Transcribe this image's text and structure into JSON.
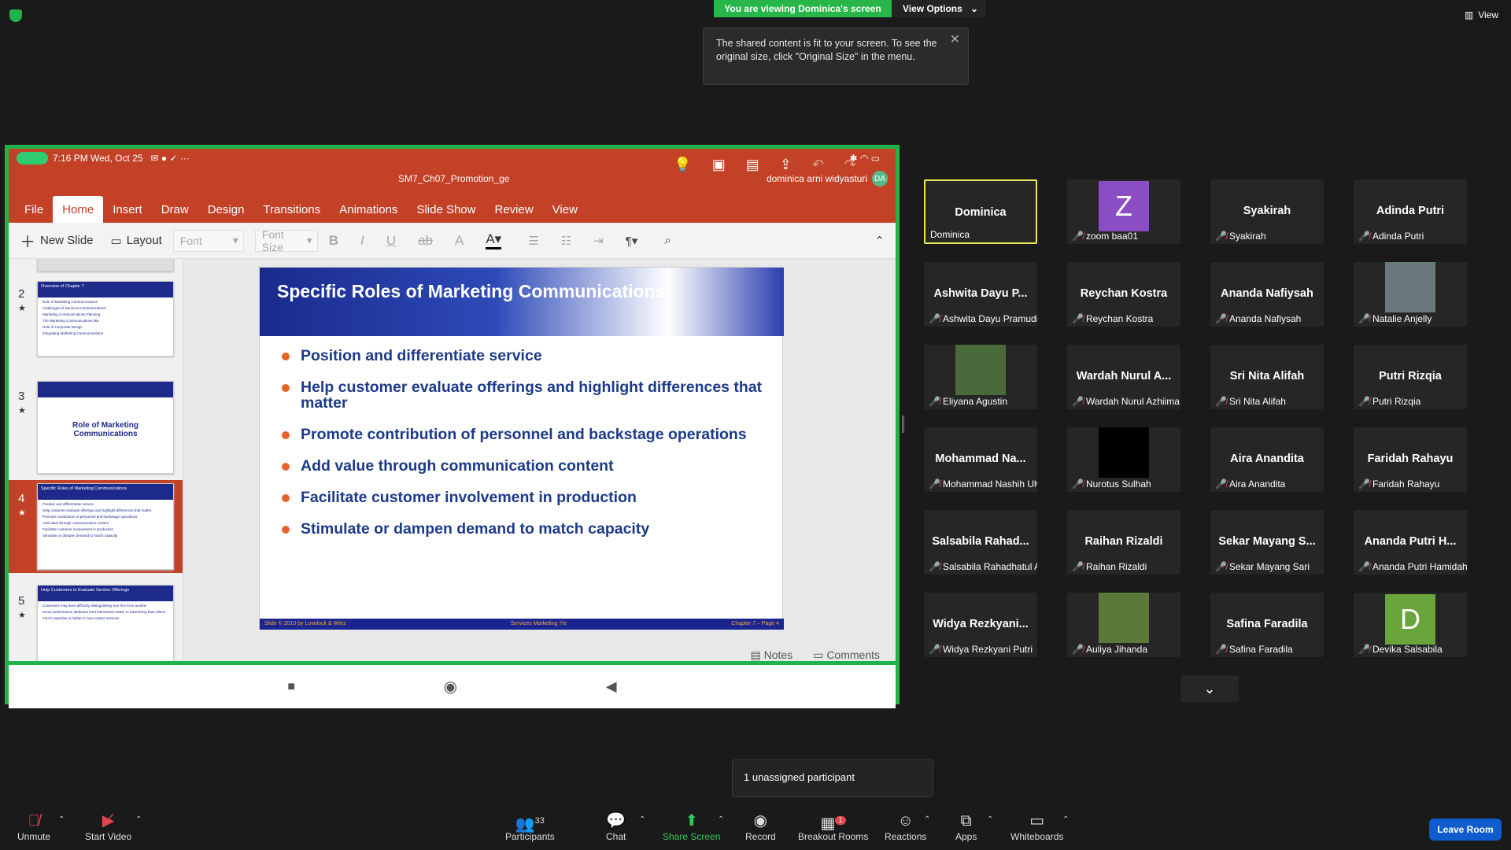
{
  "top": {
    "viewing": "You are viewing Dominica's screen",
    "view_options": "View Options",
    "tooltip": "The shared content is fit to your screen. To see the original size, click \"Original Size\" in the menu.",
    "view": "View"
  },
  "device": {
    "time": "7:16 PM Wed, Oct 25",
    "doc_title": "SM7_Ch07_Promotion_ge",
    "user": "dominica arni widyasturi",
    "initials": "DA"
  },
  "ribbon": {
    "tabs": [
      "File",
      "Home",
      "Insert",
      "Draw",
      "Design",
      "Transitions",
      "Animations",
      "Slide Show",
      "Review",
      "View"
    ]
  },
  "toolbar": {
    "new_slide": "New Slide",
    "layout": "Layout",
    "font": "Font",
    "font_size": "Font Size"
  },
  "thumbs": [
    {
      "num": "2",
      "title": "Overview of Chapter 7",
      "lines": [
        "Role of Marketing Communications",
        "Challenges of Services Communications",
        "Marketing Communications Planning",
        "The Marketing Communications Mix",
        "Role of Corporate Design",
        "Integrating Marketing Communications"
      ]
    },
    {
      "num": "3",
      "title": "Role of Marketing Communications"
    },
    {
      "num": "4",
      "title": "Specific Roles of Marketing Communications",
      "lines": [
        "Position and differentiate service",
        "Help customer evaluate offerings and highlight differences that matter",
        "Promote contribution of personnel and backstage operations",
        "Add value through communication content",
        "Facilitate customer involvement in production",
        "Stimulate or dampen demand to match capacity"
      ]
    },
    {
      "num": "5",
      "title": "Help Customers to Evaluate Service Offerings",
      "lines": [
        "Customers may have difficulty distinguishing one firm from another",
        "Some performance attributes lend themselves better to advertising than others",
        "Firm's expertise is hidden in low-contact services"
      ]
    }
  ],
  "slide": {
    "title": "Specific Roles of Marketing Communications",
    "bullets": [
      "Position and differentiate service",
      "Help customer evaluate offerings and highlight differences that matter",
      "Promote contribution of personnel and backstage operations",
      "Add value through communication content",
      "Facilitate customer involvement in production",
      "Stimulate or dampen demand to match capacity"
    ],
    "footer_left": "Slide © 2010 by Lovelock & Wirtz",
    "footer_mid": "Services Marketing 7/e",
    "footer_right": "Chapter 7 – Page 4"
  },
  "notes_bar": {
    "notes": "Notes",
    "comments": "Comments"
  },
  "gallery": [
    {
      "name": "Dominica",
      "label": "Dominica",
      "muted": false,
      "active": true
    },
    {
      "name": "",
      "label": "zoom baa01",
      "avatar": "Z",
      "color": "#8a4dc4",
      "muted": true
    },
    {
      "name": "Syakirah",
      "label": "Syakirah",
      "muted": true
    },
    {
      "name": "Adinda Putri",
      "label": "Adinda Putri",
      "muted": true
    },
    {
      "name": "Ashwita Dayu P...",
      "label": "Ashwita Dayu Pramudita",
      "muted": true
    },
    {
      "name": "Reychan Kostra",
      "label": "Reychan Kostra",
      "muted": true
    },
    {
      "name": "Ananda Nafiysah",
      "label": "Ananda Nafiysah",
      "muted": true
    },
    {
      "name": "",
      "label": "Natalie Anjelly",
      "photo": "#6a7a7c",
      "muted": true
    },
    {
      "name": "",
      "label": "Eliyana Agustin",
      "photo": "#4a6a3c",
      "muted": true
    },
    {
      "name": "Wardah Nurul A...",
      "label": "Wardah Nurul Azhiima",
      "muted": true
    },
    {
      "name": "Sri Nita Alifah",
      "label": "Sri Nita Alifah",
      "muted": true
    },
    {
      "name": "Putri Rizqia",
      "label": "Putri Rizqia",
      "muted": true
    },
    {
      "name": "Mohammad Na...",
      "label": "Mohammad Nashih Ulw...",
      "muted": true
    },
    {
      "name": "",
      "label": "Nurotus Sulhah",
      "photo": "#000000",
      "muted": true
    },
    {
      "name": "Aira Anandita",
      "label": "Aira Anandita",
      "muted": true
    },
    {
      "name": "Faridah Rahayu",
      "label": "Faridah Rahayu",
      "muted": true
    },
    {
      "name": "Salsabila Rahad...",
      "label": "Salsabila Rahadhatul Aisy",
      "muted": true
    },
    {
      "name": "Raihan Rizaldi",
      "label": "Raihan Rizaldi",
      "muted": true
    },
    {
      "name": "Sekar Mayang S...",
      "label": "Sekar Mayang Sari",
      "muted": true
    },
    {
      "name": "Ananda Putri H...",
      "label": "Ananda Putri Hamidah",
      "muted": true
    },
    {
      "name": "Widya Rezkyani...",
      "label": "Widya Rezkyani Putri",
      "muted": true
    },
    {
      "name": "",
      "label": "Auliya Jihanda",
      "photo": "#5b7a3a",
      "muted": true
    },
    {
      "name": "Safina Faradila",
      "label": "Safina Faradila",
      "muted": true
    },
    {
      "name": "",
      "label": "Devika Salsabila",
      "avatar": "D",
      "color": "#6aa53c",
      "muted": true
    }
  ],
  "bottom": {
    "unassigned": "1 unassigned participant",
    "unmute": "Unmute",
    "start_video": "Start Video",
    "participants": "Participants",
    "participants_count": "33",
    "chat": "Chat",
    "share": "Share Screen",
    "record": "Record",
    "breakout": "Breakout Rooms",
    "breakout_badge": "1",
    "reactions": "Reactions",
    "apps": "Apps",
    "whiteboards": "Whiteboards",
    "leave": "Leave Room"
  }
}
